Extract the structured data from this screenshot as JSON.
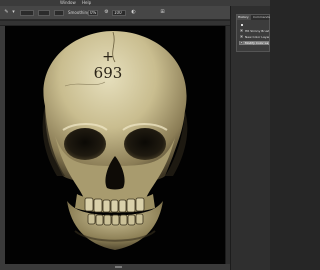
{
  "menubar": {
    "items": [
      "Window",
      "Help"
    ]
  },
  "options": {
    "zoom_value": "100",
    "smoothing_label": "Smoothing:",
    "smoothing_value": "0%",
    "flow_value": "100"
  },
  "document": {
    "tab_label": ""
  },
  "canvas": {
    "engraved_number": "693",
    "engraved_cross": "+"
  },
  "panel": {
    "tabs": [
      "History",
      "Commands"
    ],
    "rows": [
      {
        "label": "",
        "selected": false
      },
      {
        "label": "HR Skinny Brush",
        "selected": false
      },
      {
        "label": "New Color Layer",
        "selected": false
      },
      {
        "label": "Modify Color Layer",
        "selected": true
      }
    ]
  },
  "colors": {
    "canvas_bg": "#020202",
    "bone_light": "#d8cfa5",
    "bone_dark": "#6b5f3e",
    "panel_selected": "#7d7d7d"
  }
}
